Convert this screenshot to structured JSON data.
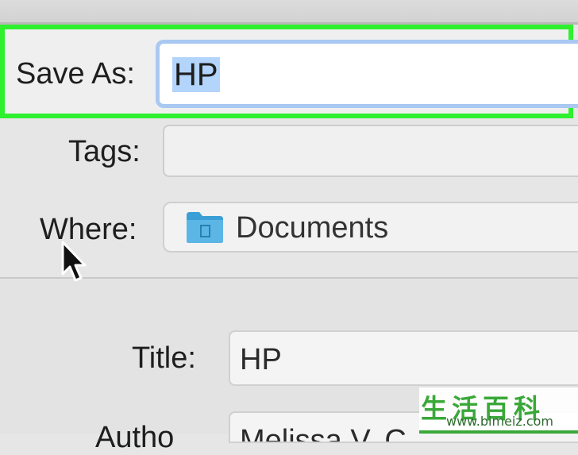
{
  "save_as": {
    "label": "Save As:",
    "value": "HP"
  },
  "tags": {
    "label": "Tags:",
    "value": ""
  },
  "where": {
    "label": "Where:",
    "value": "Documents",
    "icon": "folder-icon"
  },
  "title_field": {
    "label": "Title:",
    "value": "HP"
  },
  "author_field": {
    "label": "Autho",
    "value": "Melissa V. C"
  },
  "watermark": {
    "chars": "生活百科",
    "url": "www.bimeiz.com"
  },
  "colors": {
    "highlight": "#2ef02e",
    "selection": "#b3d4fb",
    "focus_ring": "#a9c8f2",
    "folder": "#3b9fd6",
    "watermark": "#3aa839"
  }
}
